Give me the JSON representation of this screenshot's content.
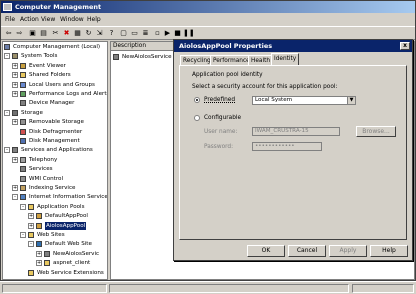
{
  "window": {
    "title": "Computer Management"
  },
  "menu": [
    "File",
    "Action",
    "View",
    "Window",
    "Help"
  ],
  "tree": [
    {
      "label": "Computer Management (Local)",
      "indent": 0,
      "expander": "",
      "icon": "computer"
    },
    {
      "label": "System Tools",
      "indent": 1,
      "expander": "-",
      "icon": "tools"
    },
    {
      "label": "Event Viewer",
      "indent": 2,
      "expander": "+",
      "icon": "event"
    },
    {
      "label": "Shared Folders",
      "indent": 2,
      "expander": "+",
      "icon": "folder"
    },
    {
      "label": "Local Users and Groups",
      "indent": 2,
      "expander": "+",
      "icon": "users"
    },
    {
      "label": "Performance Logs and Alerts",
      "indent": 2,
      "expander": "+",
      "icon": "perf"
    },
    {
      "label": "Device Manager",
      "indent": 2,
      "expander": "",
      "icon": "device"
    },
    {
      "label": "Storage",
      "indent": 1,
      "expander": "-",
      "icon": "storage"
    },
    {
      "label": "Removable Storage",
      "indent": 2,
      "expander": "+",
      "icon": "removable"
    },
    {
      "label": "Disk Defragmenter",
      "indent": 2,
      "expander": "",
      "icon": "defrag"
    },
    {
      "label": "Disk Management",
      "indent": 2,
      "expander": "",
      "icon": "disk"
    },
    {
      "label": "Services and Applications",
      "indent": 1,
      "expander": "-",
      "icon": "services"
    },
    {
      "label": "Telephony",
      "indent": 2,
      "expander": "+",
      "icon": "phone"
    },
    {
      "label": "Services",
      "indent": 2,
      "expander": "",
      "icon": "gear"
    },
    {
      "label": "WMI Control",
      "indent": 2,
      "expander": "",
      "icon": "wmi"
    },
    {
      "label": "Indexing Service",
      "indent": 2,
      "expander": "+",
      "icon": "index"
    },
    {
      "label": "Internet Information Services",
      "indent": 2,
      "expander": "-",
      "icon": "iis"
    },
    {
      "label": "Application Pools",
      "indent": 3,
      "expander": "-",
      "icon": "folder"
    },
    {
      "label": "DefaultAppPool",
      "indent": 4,
      "expander": "+",
      "icon": "pool"
    },
    {
      "label": "AiolosAppPool",
      "indent": 4,
      "expander": "+",
      "icon": "pool",
      "selected": true
    },
    {
      "label": "Web Sites",
      "indent": 3,
      "expander": "-",
      "icon": "folder"
    },
    {
      "label": "Default Web Site",
      "indent": 4,
      "expander": "-",
      "icon": "globe"
    },
    {
      "label": "NewAiolosServic",
      "indent": 5,
      "expander": "+",
      "icon": "gear"
    },
    {
      "label": "aspnet_client",
      "indent": 5,
      "expander": "+",
      "icon": "folder"
    },
    {
      "label": "Web Service Extensions",
      "indent": 3,
      "expander": "",
      "icon": "folder"
    }
  ],
  "list": {
    "header": "Description",
    "items": [
      "NewAiolosService"
    ]
  },
  "dialog": {
    "title": "AiolosAppPool Properties",
    "close": "x",
    "tabs": [
      "Recycling",
      "Performance",
      "Health",
      "Identity"
    ],
    "active_tab": "Identity",
    "group_label": "Application pool identity",
    "instruction": "Select a security account for this application pool:",
    "predefined_label": "Predefined",
    "predefined_value": "Local System",
    "configurable_label": "Configurable",
    "user_name_label": "User name:",
    "user_name_value": "IWAM_CRUSTRA-15",
    "browse_label": "Browse...",
    "password_label": "Password:",
    "password_value": "••••••••••••",
    "buttons": [
      "OK",
      "Cancel",
      "Apply",
      "Help"
    ]
  }
}
